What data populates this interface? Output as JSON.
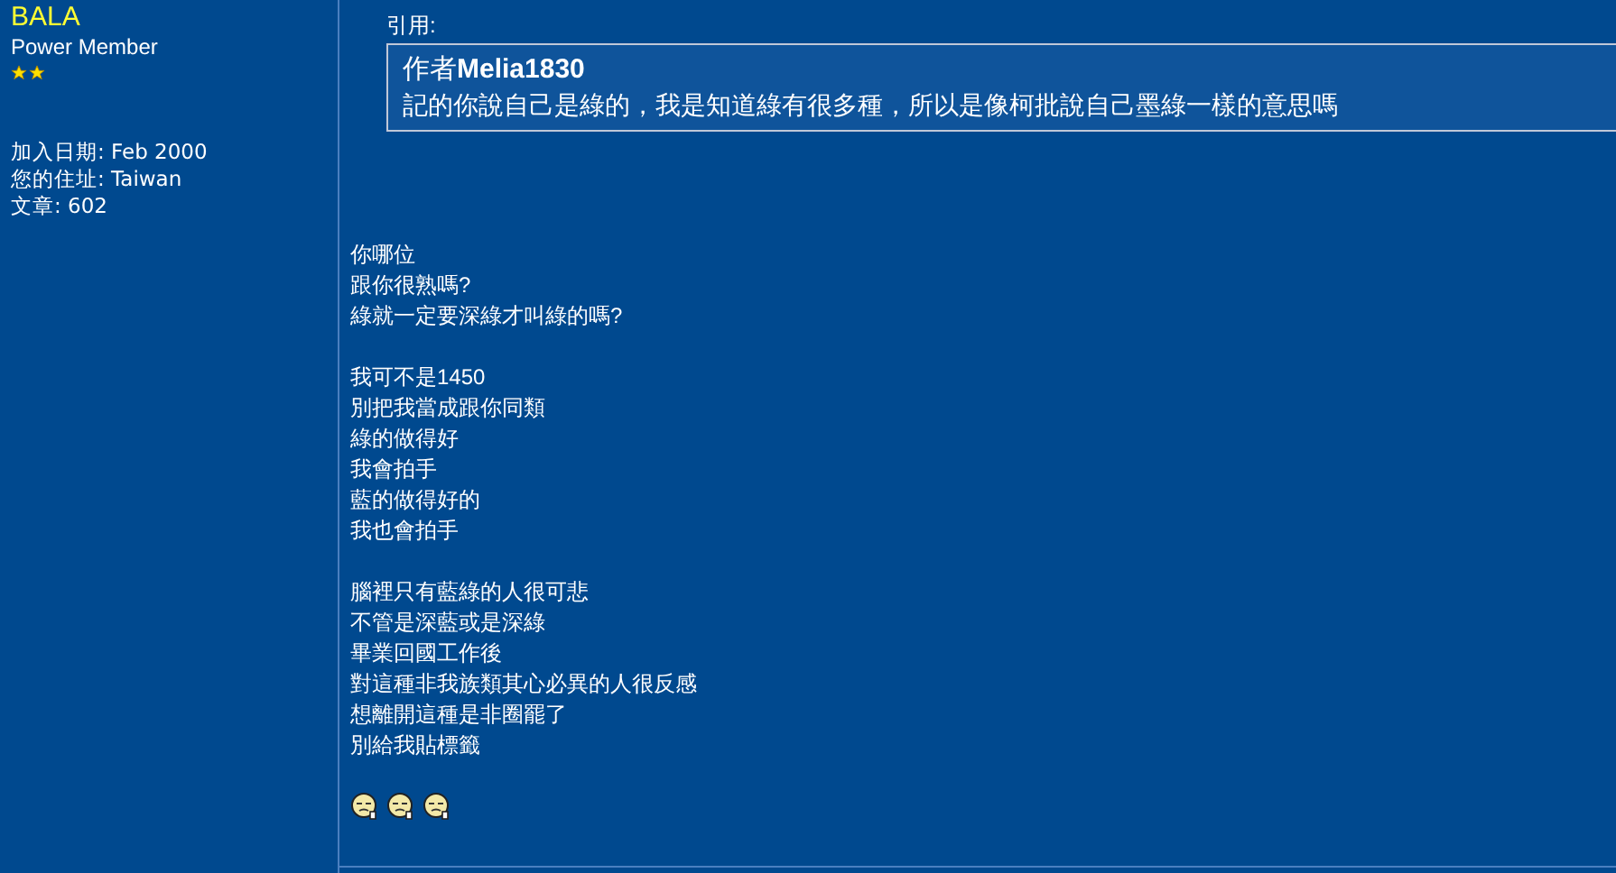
{
  "author": {
    "name": "BALA",
    "rank": "Power Member",
    "rank_icons": [
      {
        "kind": "star"
      },
      {
        "kind": "star"
      }
    ],
    "details": [
      {
        "label": "加入日期:",
        "value": "Feb 2000"
      },
      {
        "label": "您的住址:",
        "value": "Taiwan"
      },
      {
        "label": "文章:",
        "value": "602"
      }
    ]
  },
  "quote": {
    "label": "引用:",
    "prefix": "作者",
    "quoted_author": "Melia1830",
    "text": "記的你說自己是綠的，我是知道綠有很多種，所以是像柯批說自己墨綠一樣的意思嗎"
  },
  "paragraphs": [
    [
      "你哪位",
      "跟你很熟嗎?",
      "綠就一定要深綠才叫綠的嗎?"
    ],
    [
      "我可不是1450",
      "別把我當成跟你同類",
      "綠的做得好",
      "我會拍手",
      "藍的做得好的",
      "我也會拍手"
    ],
    [
      "腦裡只有藍綠的人很可悲",
      "不管是深藍或是深綠",
      "畢業回國工作後",
      "對這種非我族類其心必異的人很反感",
      "想離開這種是非圈罷了",
      "別給我貼標籤"
    ]
  ],
  "emoticons": [
    {
      "kind": "sweat"
    },
    {
      "kind": "sweat"
    },
    {
      "kind": "sweat"
    }
  ]
}
